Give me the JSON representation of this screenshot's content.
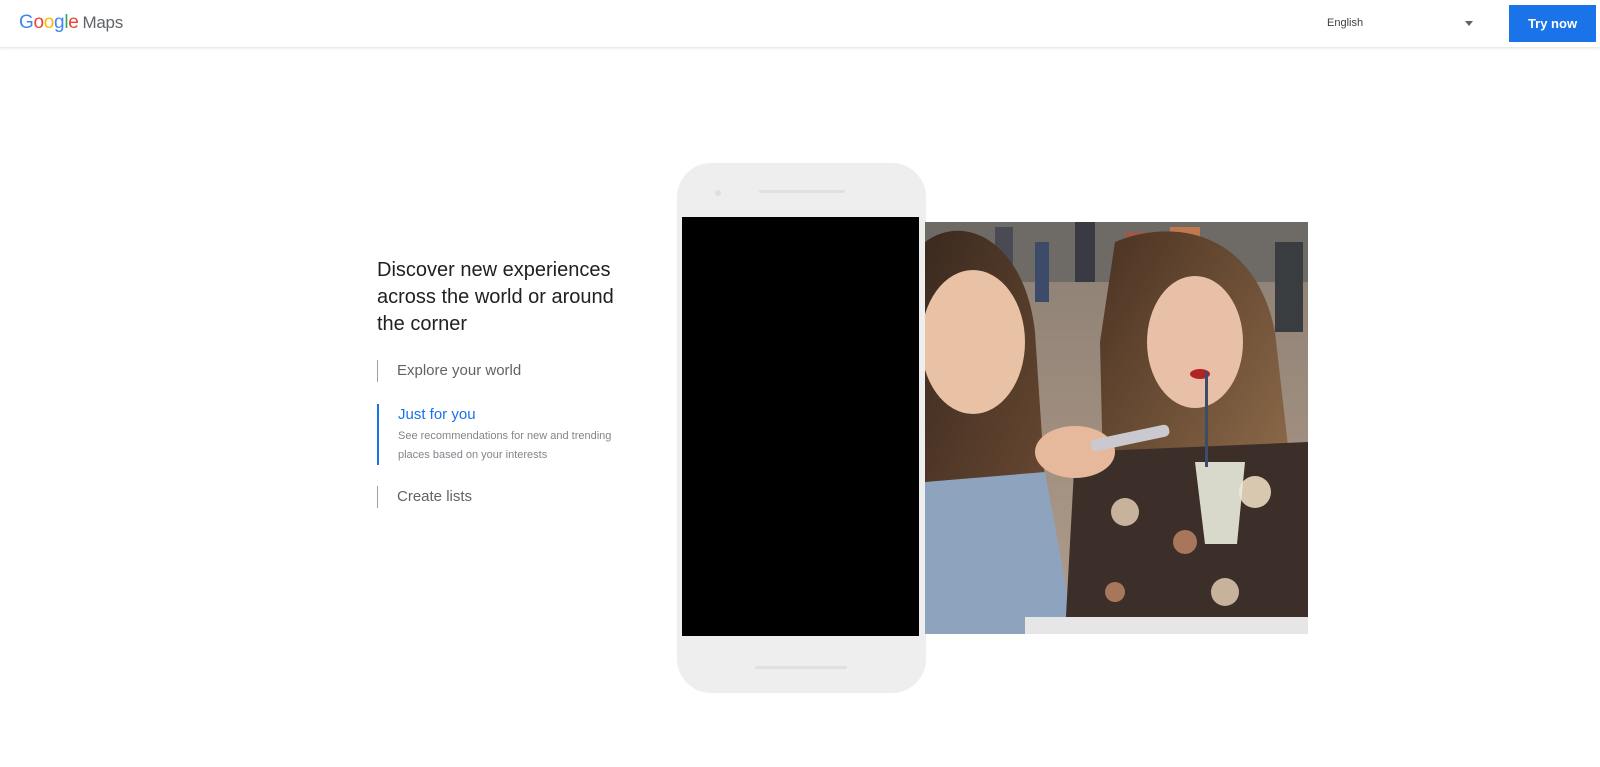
{
  "header": {
    "logo_google": [
      "G",
      "o",
      "o",
      "g",
      "l",
      "e"
    ],
    "logo_product": "Maps",
    "language_selected": "English",
    "try_button_label": "Try now"
  },
  "brand_colors": {
    "blue": "#4285F4",
    "red": "#EA4335",
    "yellow": "#FBBC05",
    "green": "#34A853",
    "accent": "#1a73e8"
  },
  "main": {
    "headline": "Discover new experiences across the world or around the corner",
    "features": [
      {
        "title": "Explore your world",
        "description": ""
      },
      {
        "title": "Just for you",
        "description": "See recommendations for new and trending places based on your interests"
      },
      {
        "title": "Create lists",
        "description": ""
      }
    ],
    "active_feature_index": 1
  },
  "icons": {
    "language_dropdown": "chevron-down-icon"
  }
}
